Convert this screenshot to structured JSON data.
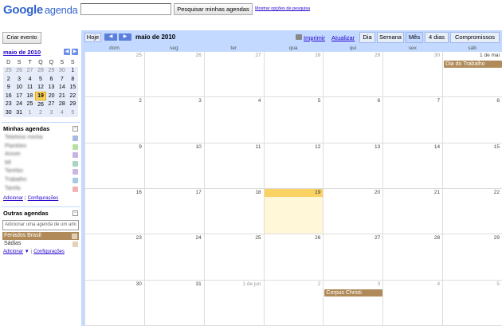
{
  "header": {
    "logo_google": "Google",
    "logo_product": "agenda",
    "search_placeholder": "",
    "search_button": "Pesquisar minhas agendas",
    "search_options": "Mostrar opções de pesquisa"
  },
  "sidebar": {
    "create_event": "Criar evento",
    "mini_cal": {
      "title": "maio de 2010",
      "weekdays": [
        "D",
        "S",
        "T",
        "Q",
        "Q",
        "S",
        "S"
      ],
      "weeks": [
        [
          {
            "d": "25",
            "dim": true
          },
          {
            "d": "26",
            "dim": true
          },
          {
            "d": "27",
            "dim": true
          },
          {
            "d": "28",
            "dim": true
          },
          {
            "d": "29",
            "dim": true
          },
          {
            "d": "30",
            "dim": true
          },
          {
            "d": "1"
          }
        ],
        [
          {
            "d": "2"
          },
          {
            "d": "3"
          },
          {
            "d": "4"
          },
          {
            "d": "5"
          },
          {
            "d": "6"
          },
          {
            "d": "7"
          },
          {
            "d": "8"
          }
        ],
        [
          {
            "d": "9"
          },
          {
            "d": "10"
          },
          {
            "d": "11"
          },
          {
            "d": "12"
          },
          {
            "d": "13"
          },
          {
            "d": "14"
          },
          {
            "d": "15"
          }
        ],
        [
          {
            "d": "16"
          },
          {
            "d": "17"
          },
          {
            "d": "18"
          },
          {
            "d": "19",
            "today": true
          },
          {
            "d": "20"
          },
          {
            "d": "21"
          },
          {
            "d": "22"
          }
        ],
        [
          {
            "d": "23"
          },
          {
            "d": "24"
          },
          {
            "d": "25"
          },
          {
            "d": "26"
          },
          {
            "d": "27"
          },
          {
            "d": "28"
          },
          {
            "d": "29"
          }
        ],
        [
          {
            "d": "30"
          },
          {
            "d": "31"
          },
          {
            "d": "1",
            "dim": true
          },
          {
            "d": "2",
            "dim": true
          },
          {
            "d": "3",
            "dim": true
          },
          {
            "d": "4",
            "dim": true
          },
          {
            "d": "5",
            "dim": true
          }
        ]
      ]
    },
    "my_calendars": {
      "title": "Minhas agendas",
      "items": [
        {
          "label": "Telefone minha",
          "color": "#a7b8e3"
        },
        {
          "label": "Plantões",
          "color": "#b6e0a3"
        },
        {
          "label": "Aniver",
          "color": "#c9b3e6"
        },
        {
          "label": "Mf",
          "color": "#a6d7c2"
        },
        {
          "label": "Tarefas",
          "color": "#cbb6e6"
        },
        {
          "label": "Trabalho",
          "color": "#a3c9e6"
        },
        {
          "label": "Tarefa",
          "color": "#f0b2b2"
        }
      ],
      "links": [
        "Adicionar",
        "Configurações"
      ]
    },
    "other_calendars": {
      "title": "Outras agendas",
      "add_placeholder": "Adicionar uma agenda de um ami",
      "items": [
        {
          "label": "Feriados Brasil",
          "color": "#b08b59"
        },
        {
          "label": "Sádias",
          "color": "#e6d2b4"
        }
      ],
      "links": [
        "Adicionar",
        "Configurações"
      ]
    }
  },
  "toolbar": {
    "today": "Hoje",
    "title": "maio de 2010",
    "print": "Imprimir",
    "refresh": "Atualizar",
    "views": [
      "Dia",
      "Semana",
      "Mês",
      "4 dias",
      "Compromissos"
    ],
    "active_view": "Mês"
  },
  "month": {
    "weekday_headers": [
      "dom",
      "seg",
      "ter",
      "qua",
      "qui",
      "sex",
      "sáb"
    ],
    "weeks": [
      [
        {
          "d": "25",
          "dim": true
        },
        {
          "d": "26",
          "dim": true
        },
        {
          "d": "27",
          "dim": true
        },
        {
          "d": "28",
          "dim": true
        },
        {
          "d": "29",
          "dim": true
        },
        {
          "d": "30",
          "dim": true
        },
        {
          "d": "1 de mai"
        }
      ],
      [
        {
          "d": "2"
        },
        {
          "d": "3"
        },
        {
          "d": "4"
        },
        {
          "d": "5"
        },
        {
          "d": "6"
        },
        {
          "d": "7"
        },
        {
          "d": "8"
        }
      ],
      [
        {
          "d": "9"
        },
        {
          "d": "10"
        },
        {
          "d": "11"
        },
        {
          "d": "12"
        },
        {
          "d": "13"
        },
        {
          "d": "14"
        },
        {
          "d": "15"
        }
      ],
      [
        {
          "d": "16"
        },
        {
          "d": "17"
        },
        {
          "d": "18"
        },
        {
          "d": "19",
          "today": true
        },
        {
          "d": "20"
        },
        {
          "d": "21"
        },
        {
          "d": "22"
        }
      ],
      [
        {
          "d": "23"
        },
        {
          "d": "24"
        },
        {
          "d": "25"
        },
        {
          "d": "26"
        },
        {
          "d": "27"
        },
        {
          "d": "28"
        },
        {
          "d": "29"
        }
      ],
      [
        {
          "d": "30"
        },
        {
          "d": "31"
        },
        {
          "d": "1 de jun",
          "dim": true
        },
        {
          "d": "2",
          "dim": true
        },
        {
          "d": "3",
          "dim": true
        },
        {
          "d": "4",
          "dim": true
        },
        {
          "d": "5",
          "dim": true
        }
      ]
    ],
    "events": [
      {
        "title": "Dia do Trabalho",
        "week": 0,
        "day": 6,
        "color": "#b08b59"
      },
      {
        "title": "Corpus Christi",
        "week": 5,
        "day": 4,
        "color": "#b08b59"
      }
    ]
  },
  "colors": {
    "accent": "#c3d9ff",
    "today": "#fad163",
    "holiday_event": "#b08b59"
  }
}
